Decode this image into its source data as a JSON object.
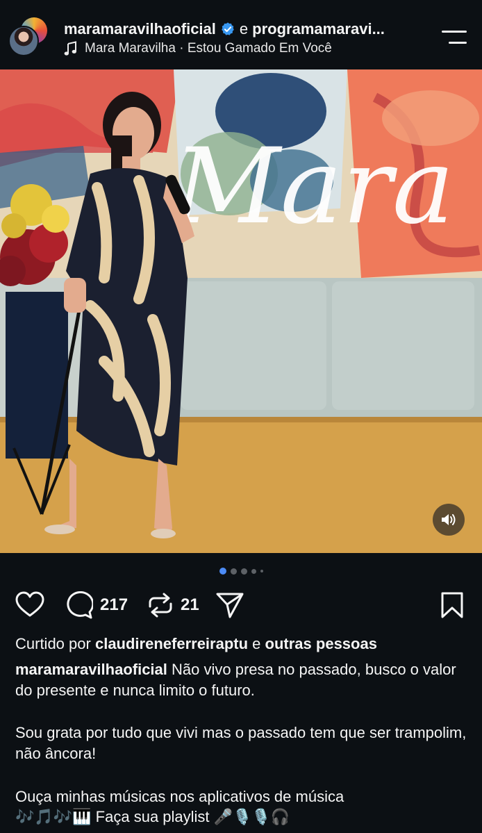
{
  "header": {
    "account_primary": "maramaravilhaoficial",
    "conjunction": "e",
    "account_secondary": "programamaravi...",
    "music_text": "Mara Maravilha · Estou Gamado Em Você"
  },
  "photo": {
    "backdrop_word": "Mara"
  },
  "carousel": {
    "total_dots": 5,
    "active_index": 0
  },
  "actions": {
    "comments_count": "217",
    "reposts_count": "21"
  },
  "likes": {
    "prefix": "Curtido por",
    "liker": "claudireneferreiraptu",
    "joiner": "e",
    "others": "outras pessoas"
  },
  "caption": {
    "author": "maramaravilhaoficial",
    "line1": "Não vivo presa no passado, busco o valor do presente e nunca limito o futuro.",
    "paragraph2": "Sou grata por tudo que vivi mas o passado tem que ser trampolim, não âncora!",
    "paragraph3_line1": "Ouça minhas músicas nos aplicativos de música",
    "paragraph3_line2": "🎶🎵🎶🎹 Faça sua playlist 🎤🎙️🎙️🎧"
  },
  "colors": {
    "background": "#0c1014",
    "text": "#f5f5f5",
    "verified": "#3897f0",
    "dot_active": "#4c8bf5",
    "dot_inactive": "#5d6166"
  },
  "icons": [
    "verified-badge-icon",
    "music-note-icon",
    "menu-icon",
    "heart-icon",
    "comment-icon",
    "repost-icon",
    "share-icon",
    "bookmark-icon",
    "sound-icon"
  ]
}
